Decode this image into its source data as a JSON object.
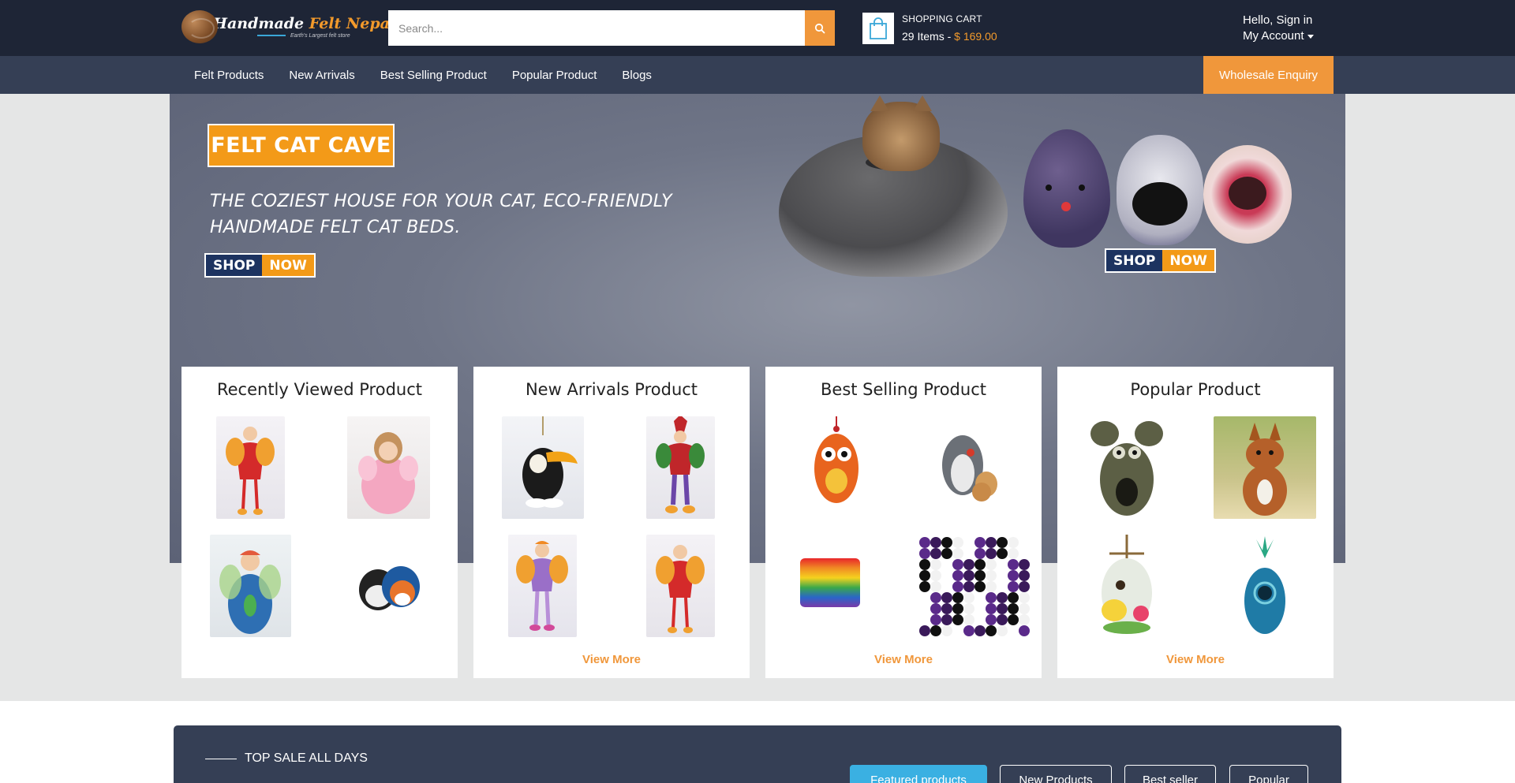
{
  "header": {
    "logo_title_main": "Handmade ",
    "logo_title_accent": "Felt Nepal",
    "logo_tagline": "Earth's Largest felt store",
    "search_placeholder": "Search...",
    "cart_title": "SHOPPING CART",
    "cart_items": "29 Items - ",
    "cart_total": "$ 169.00",
    "greeting": "Hello, Sign in",
    "account_label": "My Account"
  },
  "nav": {
    "items": [
      "Felt Products",
      "New Arrivals",
      "Best Selling Product",
      "Popular Product",
      "Blogs"
    ],
    "wholesale": "Wholesale Enquiry"
  },
  "banner": {
    "badge": "FELT CAT CAVE",
    "tagline_line1": "THE COZIEST HOUSE FOR YOUR CAT, ECO-FRIENDLY",
    "tagline_line2": "HANDMADE FELT CAT BEDS.",
    "shop_word": "SHOP",
    "now_word": "NOW"
  },
  "panels": [
    {
      "title": "Recently Viewed Product",
      "view_more": ""
    },
    {
      "title": "New Arrivals Product",
      "view_more": "View More"
    },
    {
      "title": "Best Selling Product",
      "view_more": "View More"
    },
    {
      "title": "Popular Product",
      "view_more": "View More"
    }
  ],
  "top_sale": {
    "label": "TOP SALE ALL DAYS",
    "tabs": [
      "Featured products",
      "New Products",
      "Best seller",
      "Popular"
    ]
  },
  "colors": {
    "header_bg": "#1e2536",
    "nav_bg": "#353f55",
    "accent_orange": "#f0973b",
    "tab_active": "#3ab0e2"
  }
}
